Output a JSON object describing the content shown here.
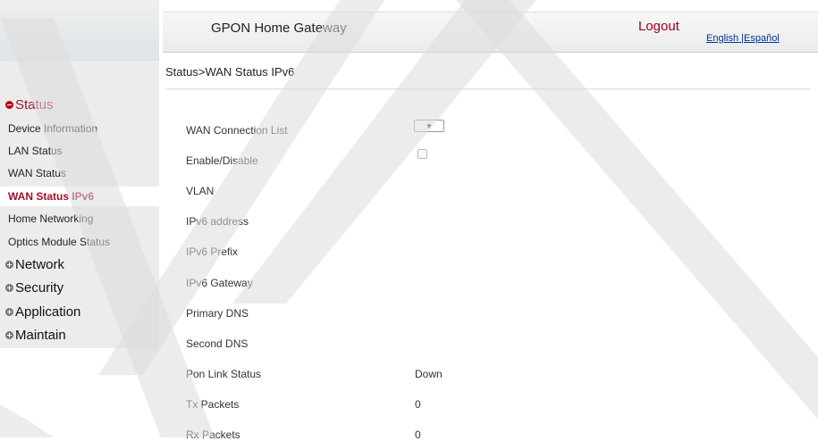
{
  "header": {
    "title": "GPON Home Gateway",
    "logout": "Logout",
    "lang_english": "English",
    "lang_sep": " |",
    "lang_spanish": "Español"
  },
  "breadcrumb": "Status>WAN Status IPv6",
  "sidebar": {
    "status": "Status",
    "items": [
      {
        "label": "Device Information"
      },
      {
        "label": "LAN Status"
      },
      {
        "label": "WAN Status"
      },
      {
        "label": "WAN Status IPv6",
        "active": true
      },
      {
        "label": "Home Networking"
      },
      {
        "label": "Optics Module Status"
      }
    ],
    "network": "Network",
    "security": "Security",
    "application": "Application",
    "maintain": "Maintain"
  },
  "form": {
    "wan_connection_list": "WAN Connection List",
    "enable_disable": "Enable/Disable",
    "vlan": "VLAN",
    "ipv6_address": "IPv6 address",
    "ipv6_prefix": "IPv6 Prefix",
    "ipv6_gateway": "IPv6 Gateway",
    "primary_dns": "Primary DNS",
    "second_dns": "Second DNS",
    "pon_link_status": "Pon Link Status",
    "pon_link_status_value": "Down",
    "tx_packets": "Tx Packets",
    "tx_packets_value": "0",
    "rx_packets": "Rx Packets",
    "rx_packets_value": "0",
    "select_arrow": "▼"
  },
  "colors": {
    "accent": "#a0102a",
    "sidebar_bg": "#ececec"
  }
}
